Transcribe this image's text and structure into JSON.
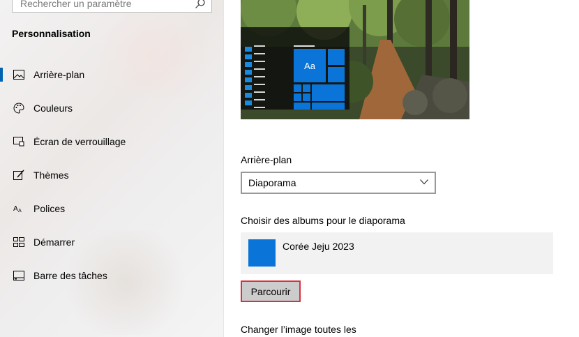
{
  "sidebar": {
    "search": {
      "placeholder": "Rechercher un paramètre"
    },
    "section_title": "Personnalisation",
    "items": [
      {
        "label": "Arrière-plan",
        "icon": "picture-icon",
        "active": true
      },
      {
        "label": "Couleurs",
        "icon": "palette-icon",
        "active": false
      },
      {
        "label": "Écran de verrouillage",
        "icon": "lock-screen-icon",
        "active": false
      },
      {
        "label": "Thèmes",
        "icon": "themes-icon",
        "active": false
      },
      {
        "label": "Polices",
        "icon": "fonts-icon",
        "active": false
      },
      {
        "label": "Démarrer",
        "icon": "start-icon",
        "active": false
      },
      {
        "label": "Barre des tâches",
        "icon": "taskbar-icon",
        "active": false
      }
    ]
  },
  "main": {
    "preview": {
      "tile_text": "Aa"
    },
    "background_label": "Arrière-plan",
    "background_value": "Diaporama",
    "albums_label": "Choisir des albums pour le diaporama",
    "album_name": "Corée Jeju 2023",
    "browse_label": "Parcourir",
    "change_label": "Changer l’image toutes les"
  },
  "colors": {
    "accent": "#0078d7",
    "highlight_border": "#d9323e"
  }
}
